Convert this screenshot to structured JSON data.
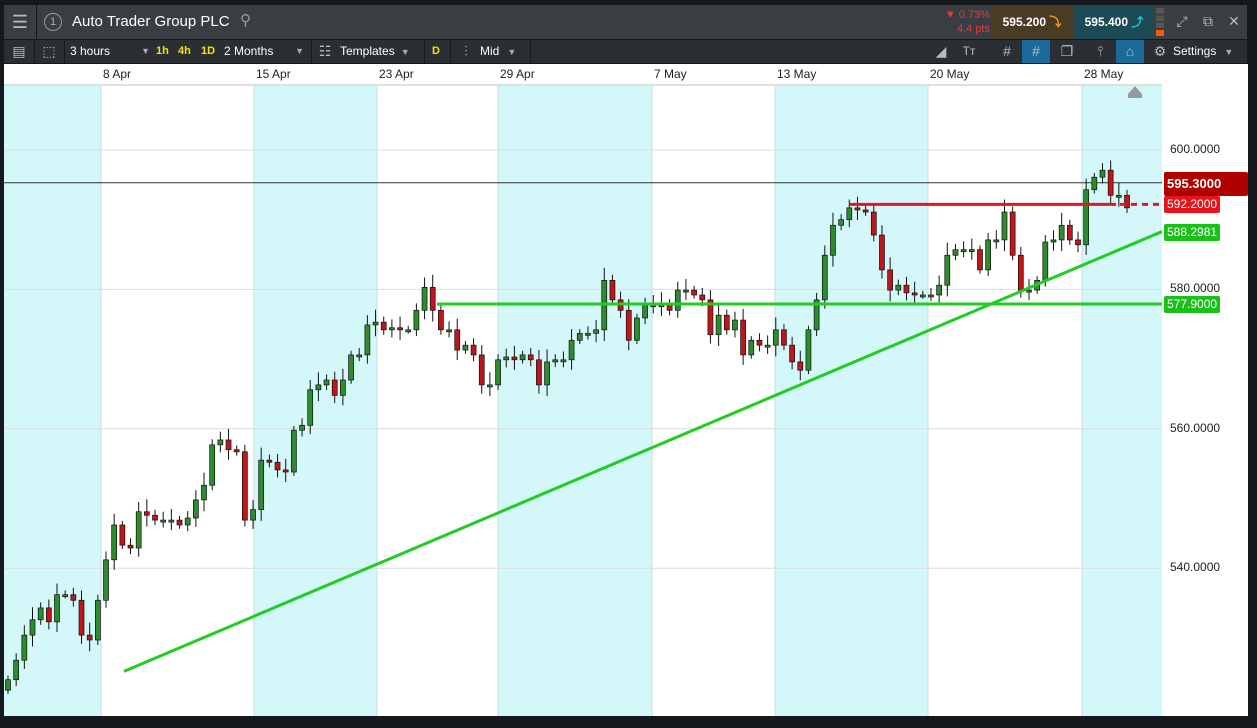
{
  "header": {
    "title": "Auto Trader Group PLC",
    "window_number": "1",
    "change_pct": "0.73%",
    "change_pts": "4.4 pts",
    "sell_price": "595.200",
    "buy_price": "595.400"
  },
  "toolbar": {
    "interval": "3 hours",
    "quick": [
      "1h",
      "4h",
      "1D"
    ],
    "range": "2 Months",
    "templates": "Templates",
    "d_label": "D",
    "price_type": "Mid",
    "settings": "Settings"
  },
  "colors": {
    "up": "#2e8b2e",
    "down": "#c0161b",
    "band": "#d4f8fa",
    "trend": "#22cc22",
    "resistance": "#e8141b"
  },
  "chart_data": {
    "type": "candlestick",
    "title": "Auto Trader Group PLC",
    "x_tick_labels": [
      "8 Apr",
      "15 Apr",
      "23 Apr",
      "29 Apr",
      "7 May",
      "13 May",
      "20 May",
      "28 May"
    ],
    "y_tick_labels": [
      "600.0000",
      "580.0000",
      "560.0000",
      "540.0000"
    ],
    "y_ticks": [
      600,
      580,
      560,
      540
    ],
    "ylim": [
      513,
      610
    ],
    "first_open": 522.5,
    "closes": [
      524.0,
      526.8,
      530.4,
      532.6,
      534.3,
      532.3,
      536.2,
      536.2,
      535.4,
      530.4,
      529.7,
      535.4,
      541.2,
      546.2,
      543.3,
      542.9,
      548.1,
      547.6,
      546.9,
      546.9,
      546.9,
      546.2,
      547.2,
      549.8,
      551.9,
      557.7,
      558.4,
      557.0,
      556.7,
      546.9,
      548.4,
      555.5,
      555.2,
      554.1,
      553.8,
      559.8,
      560.5,
      565.6,
      566.3,
      567.0,
      564.8,
      567.0,
      570.6,
      570.6,
      574.9,
      575.3,
      574.2,
      574.5,
      574.2,
      574.2,
      577.0,
      580.3,
      577.0,
      574.2,
      574.2,
      571.3,
      572.0,
      570.6,
      566.3,
      566.3,
      569.9,
      570.3,
      569.9,
      570.6,
      569.9,
      566.3,
      569.6,
      569.9,
      569.9,
      572.7,
      573.7,
      573.7,
      574.2,
      581.3,
      578.5,
      577.0,
      572.7,
      575.9,
      577.8,
      577.8,
      577.8,
      577.0,
      579.9,
      579.9,
      579.2,
      578.5,
      573.5,
      576.3,
      574.2,
      575.6,
      570.6,
      572.7,
      572.0,
      572.0,
      574.2,
      572.0,
      569.6,
      568.4,
      574.2,
      578.5,
      584.9,
      589.2,
      590.0,
      591.7,
      591.4,
      591.1,
      587.8,
      582.8,
      579.9,
      580.6,
      579.5,
      579.2,
      579.2,
      579.2,
      580.6,
      584.9,
      585.7,
      585.7,
      585.7,
      582.8,
      587.1,
      587.1,
      591.1,
      584.9,
      579.9,
      579.9,
      581.3,
      586.8,
      587.1,
      589.2,
      587.1,
      586.4,
      594.3,
      596.1,
      597.1,
      593.5,
      593.5,
      591.7
    ],
    "current_price": "595.3000",
    "current_value": 595.3,
    "levels": [
      {
        "name": "resistance",
        "value": 592.2,
        "label": "592.2000"
      },
      {
        "name": "trendline-end",
        "value": 588.2981,
        "label": "588.2981"
      },
      {
        "name": "support",
        "value": 577.9,
        "label": "577.9000"
      }
    ],
    "trendline": {
      "start_value": 525.2,
      "end_value": 588.2981
    }
  }
}
